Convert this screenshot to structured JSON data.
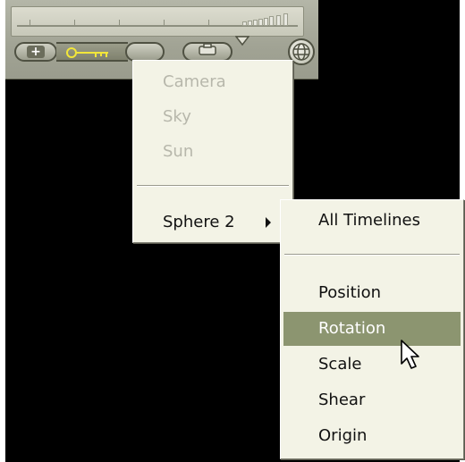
{
  "toolbar": {
    "buttons": [
      "add-keyframe",
      "keyframe",
      "remove-keyframe",
      "camera-lock",
      "options-dropdown",
      "globe"
    ]
  },
  "menu": {
    "items": [
      {
        "label": "Camera",
        "enabled": false
      },
      {
        "label": "Sky",
        "enabled": false
      },
      {
        "label": "Sun",
        "enabled": false
      },
      {
        "label": "Sphere 2",
        "enabled": true,
        "has_submenu": true
      }
    ]
  },
  "submenu": {
    "items": [
      {
        "label": "All Timelines"
      },
      {
        "label": "Position"
      },
      {
        "label": "Rotation",
        "highlighted": true
      },
      {
        "label": "Scale"
      },
      {
        "label": "Shear"
      },
      {
        "label": "Origin"
      }
    ]
  },
  "colors": {
    "toolbar_bg": "#a1a394",
    "menu_bg": "#f3f3e6",
    "highlight_bg": "#8c9570",
    "disabled_text": "#b7b7ab",
    "key_accent": "#f2e63a"
  }
}
